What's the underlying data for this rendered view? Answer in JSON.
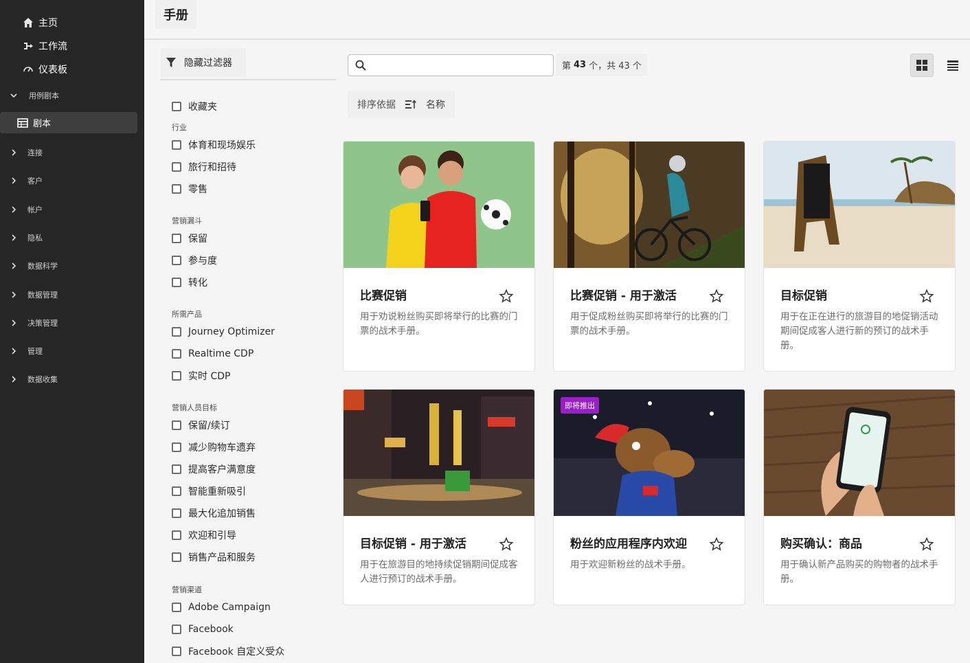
{
  "nav": {
    "top_items": [
      {
        "label": "主页",
        "icon": "home-icon"
      },
      {
        "label": "工作流",
        "icon": "workflow-icon"
      },
      {
        "label": "仪表板",
        "icon": "dashboard-icon"
      }
    ],
    "playbooks_section": "用例剧本",
    "playbooks_item": "剧本",
    "sections": [
      "连接",
      "客户",
      "帐户",
      "隐私",
      "数据科学",
      "数据管理",
      "决策管理",
      "管理",
      "数据收集"
    ]
  },
  "header": {
    "title": "手册"
  },
  "filter": {
    "toggle_label": "隐藏过滤器",
    "favorites": "收藏夹",
    "groups": [
      {
        "label": "行业",
        "options": [
          "体育和现场娱乐",
          "旅行和招待",
          "零售"
        ]
      },
      {
        "label": "营销漏斗",
        "options": [
          "保留",
          "参与度",
          "转化"
        ]
      },
      {
        "label": "所需产品",
        "options": [
          "Journey Optimizer",
          "Realtime CDP",
          "实时 CDP"
        ]
      },
      {
        "label": "营销人员目标",
        "options": [
          "保留/续订",
          "减少购物车遗弃",
          "提高客户满意度",
          "智能重新吸引",
          "最大化追加销售",
          "欢迎和引导",
          "销售产品和服务"
        ]
      },
      {
        "label": "营销渠道",
        "options": [
          "Adobe Campaign",
          "Facebook",
          "Facebook 自定义受众"
        ]
      }
    ]
  },
  "toolbar": {
    "search_value": "",
    "count_prefix": "第",
    "count_shown": "43",
    "count_suffix": "个，共 43 个",
    "sort_label": "排序依据",
    "sort_value": "名称"
  },
  "cards": [
    {
      "title": "比赛促销",
      "desc": "用于劝说粉丝购买即将举行的比赛的门票的战术手册。",
      "badge": ""
    },
    {
      "title": "比赛促销 - 用于激活",
      "desc": "用于促成粉丝购买即将举行的比赛的门票的战术手册。",
      "badge": ""
    },
    {
      "title": "目标促销",
      "desc": "用于在正在进行的旅游目的地促销活动期间促成客人进行新的预订的战术手册。",
      "badge": ""
    },
    {
      "title": "目标促销 - 用于激活",
      "desc": "用于在旅游目的地持续促销期间促成客人进行预订的战术手册。",
      "badge": ""
    },
    {
      "title": "粉丝的应用程序内欢迎",
      "desc": "用于欢迎新粉丝的战术手册。",
      "badge": "即将推出"
    },
    {
      "title": "购买确认：商品",
      "desc": "用于确认新产品购买的购物者的战术手册。",
      "badge": ""
    }
  ],
  "colors": {
    "nav_bg": "#262626",
    "badge": "#9b1fc9",
    "page_bg": "#f5f5f5"
  }
}
